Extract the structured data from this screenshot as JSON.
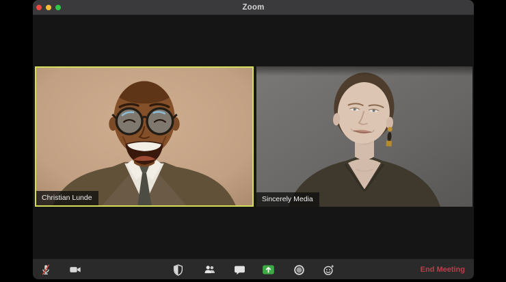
{
  "window": {
    "title": "Zoom"
  },
  "titlebar": {
    "traffic_lights": [
      {
        "name": "close",
        "color": "#ee4b40"
      },
      {
        "name": "minimize",
        "color": "#f8bd35"
      },
      {
        "name": "maximize",
        "color": "#2fc943"
      }
    ]
  },
  "participants": [
    {
      "name": "Christian Lunde",
      "active_speaker": true
    },
    {
      "name": "Sincerely Media",
      "active_speaker": false
    }
  ],
  "colors": {
    "active_speaker_border": "#d5de5a",
    "share_button_green": "#3cab44",
    "end_meeting_red": "#b5404a",
    "mute_slash_red": "#e04c3c",
    "titlebar_bg": "#3a3a3c",
    "toolbar_bg": "#2a2a2b"
  },
  "toolbar": {
    "buttons": [
      {
        "icon": "microphone-muted-icon"
      },
      {
        "icon": "video-camera-icon"
      },
      {
        "icon": "security-shield-icon"
      },
      {
        "icon": "participants-icon"
      },
      {
        "icon": "chat-bubble-icon"
      },
      {
        "icon": "share-screen-icon"
      },
      {
        "icon": "record-icon"
      },
      {
        "icon": "reactions-smiley-icon"
      }
    ],
    "end_meeting_label": "End Meeting"
  }
}
